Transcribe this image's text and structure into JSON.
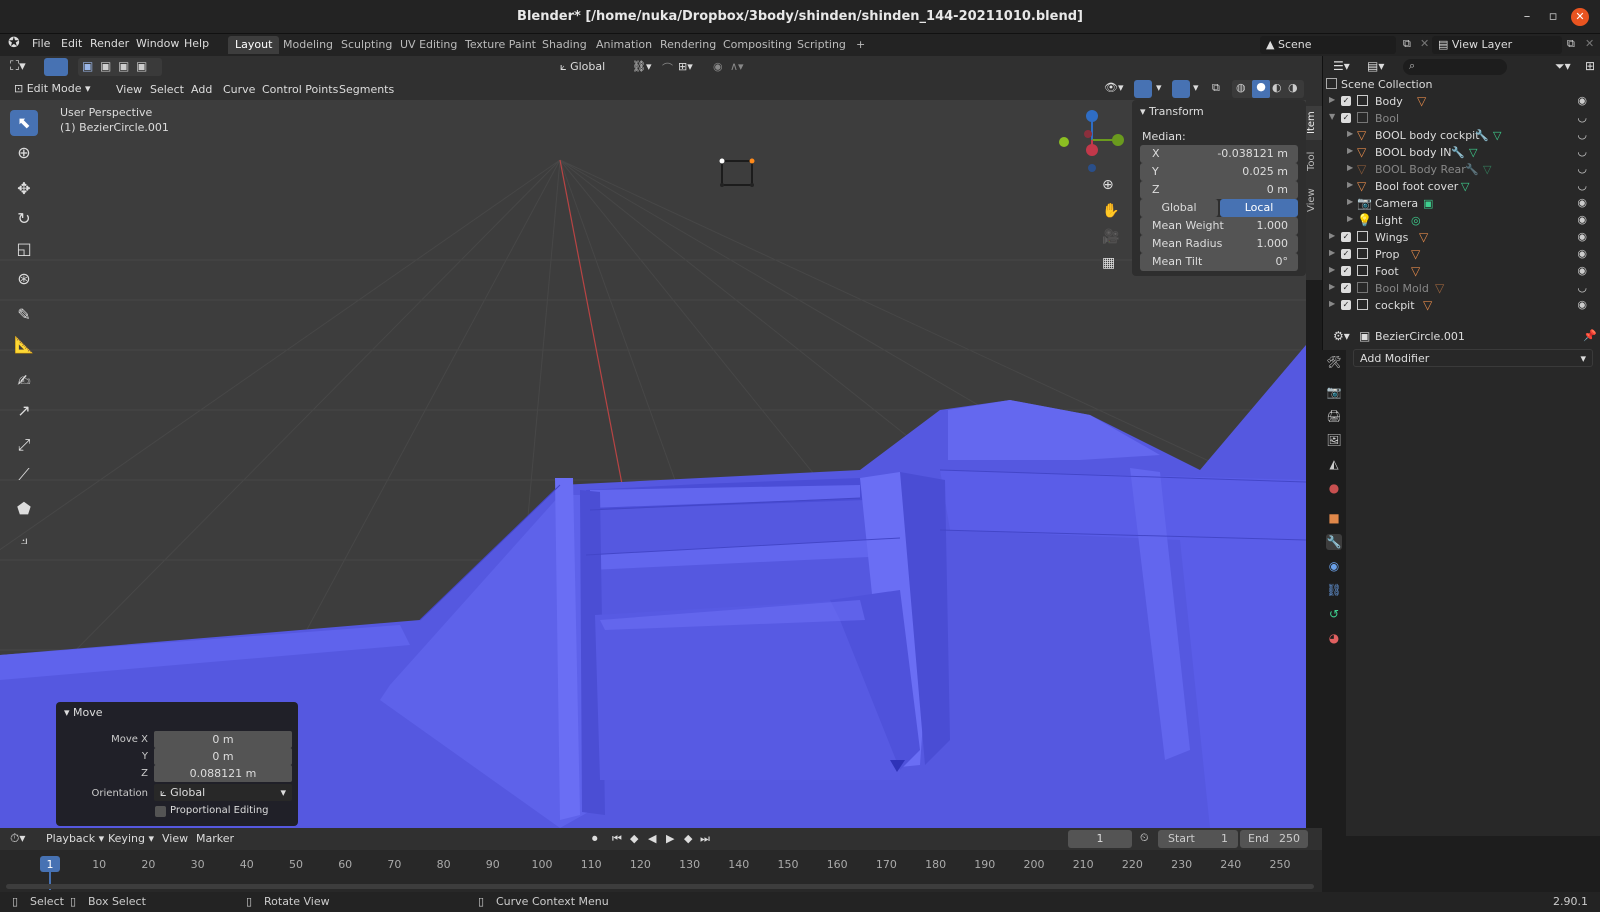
{
  "window": {
    "title": "Blender* [/home/nuka/Dropbox/3body/shinden/shinden_144-20211010.blend]",
    "minimize": "–",
    "maximize": "▫",
    "close": "✕"
  },
  "menu": [
    "File",
    "Edit",
    "Render",
    "Window",
    "Help"
  ],
  "workspaces": [
    "Layout",
    "Modeling",
    "Sculpting",
    "UV Editing",
    "Texture Paint",
    "Shading",
    "Animation",
    "Rendering",
    "Compositing",
    "Scripting",
    "+"
  ],
  "scene": {
    "scene_name": "Scene",
    "view_layer": "View Layer"
  },
  "header1": {
    "orientation": "Global"
  },
  "header2": {
    "mode": "Edit Mode",
    "items": [
      "View",
      "Select",
      "Add",
      "Curve",
      "Control Points",
      "Segments"
    ]
  },
  "viewport": {
    "perspective": "User Perspective",
    "object": "(1) BezierCircle.001"
  },
  "npanel": {
    "title": "Transform",
    "median": "Median:",
    "x_label": "X",
    "x_value": "-0.038121 m",
    "y_label": "Y",
    "y_value": "0.025 m",
    "z_label": "Z",
    "z_value": "0 m",
    "global": "Global",
    "local": "Local",
    "mean_weight_label": "Mean Weight",
    "mean_weight": "1.000",
    "mean_radius_label": "Mean Radius",
    "mean_radius": "1.000",
    "mean_tilt_label": "Mean Tilt",
    "mean_tilt": "0°",
    "tabs": [
      "Item",
      "Tool",
      "View"
    ]
  },
  "move_panel": {
    "title": "Move",
    "move_x_label": "Move X",
    "move_x": "0 m",
    "y_label": "Y",
    "y": "0 m",
    "z_label": "Z",
    "z": "0.088121 m",
    "orientation_label": "Orientation",
    "orientation": "Global",
    "proportional": "Proportional Editing"
  },
  "outliner": {
    "root": "Scene Collection",
    "rows": [
      {
        "name": "Body",
        "badge": "4"
      },
      {
        "name": "Bool"
      },
      {
        "name": "BOOL body cockpit"
      },
      {
        "name": "BOOL body IN"
      },
      {
        "name": "BOOL Body Rear"
      },
      {
        "name": "Bool foot cover"
      },
      {
        "name": "Camera"
      },
      {
        "name": "Light"
      },
      {
        "name": "Wings",
        "badge": "3"
      },
      {
        "name": "Prop",
        "badge": "8"
      },
      {
        "name": "Foot",
        "badge": "8"
      },
      {
        "name": "Bool Mold",
        "badge": "11"
      },
      {
        "name": "cockpit",
        "badge": "3",
        "badge2": "6"
      }
    ]
  },
  "properties": {
    "object": "BezierCircle.001",
    "add_modifier": "Add Modifier"
  },
  "timeline": {
    "items": [
      "Playback",
      "Keying",
      "View",
      "Marker"
    ],
    "current_frame": "1",
    "start_label": "Start",
    "start": "1",
    "end_label": "End",
    "end": "250",
    "ticks": [
      "1",
      "10",
      "20",
      "30",
      "40",
      "50",
      "60",
      "70",
      "80",
      "90",
      "100",
      "110",
      "120",
      "130",
      "140",
      "150",
      "160",
      "170",
      "180",
      "190",
      "200",
      "210",
      "220",
      "230",
      "240",
      "250"
    ]
  },
  "status": {
    "select": "Select",
    "box_select": "Box Select",
    "rotate_view": "Rotate View",
    "context": "Curve Context Menu",
    "version": "2.90.1"
  },
  "colors": {
    "accent": "#4772b3",
    "mesh": "#5a5ee8",
    "viewport_bg": "#3d3d3d"
  }
}
